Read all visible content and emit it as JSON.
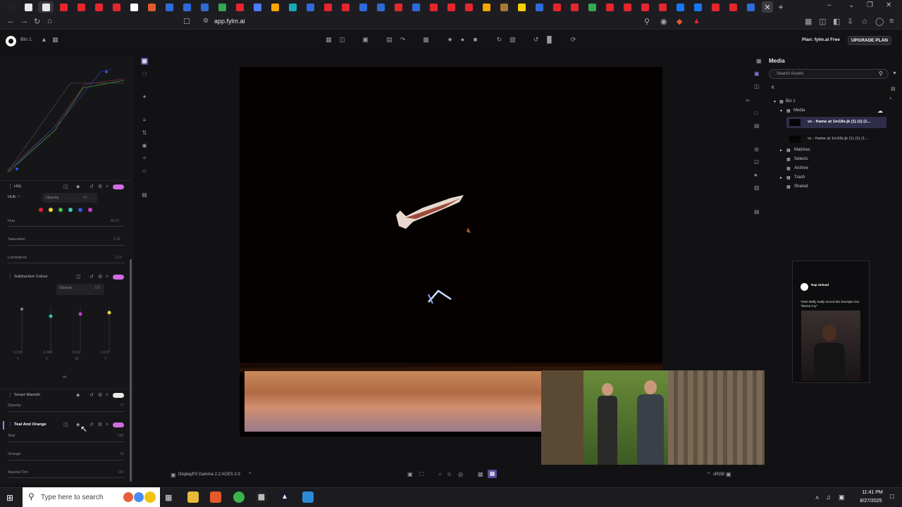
{
  "browser": {
    "url": "app.fylm.ai",
    "tab_count": 44,
    "tab_colors": [
      "#222",
      "#e8e8e8",
      "#e8e8e8",
      "#e5262d",
      "#e5262d",
      "#e5262d",
      "#e5262d",
      "#fff",
      "#e05a2c",
      "#2f6bd8",
      "#2f6bd8",
      "#2f6bd8",
      "#34a853",
      "#e5262d",
      "#4d7cff",
      "#f7a800",
      "#1ba9b5",
      "#2f6bd8",
      "#e5262d",
      "#e5262d",
      "#2f6bd8",
      "#2f6bd8",
      "#e5262d",
      "#2f6bd8",
      "#e5262d",
      "#e5262d",
      "#e5262d",
      "#f7a800",
      "#a57a33",
      "#f4d000",
      "#2f6bd8",
      "#e5262d",
      "#e5262d",
      "#34a853",
      "#e5262d",
      "#e5262d",
      "#e5262d",
      "#e5262d",
      "#1877f2",
      "#1877f2",
      "#e5262d",
      "#e5262d",
      "#2f6bd8"
    ]
  },
  "app": {
    "project_name": "Bin 1",
    "plan_label": "Plan: fylm.ai Free",
    "upgrade_label": "UPGRADE PLAN"
  },
  "left_panel": {
    "hsl": {
      "title": "HSL",
      "mode": "HUE",
      "opacity_label": "Opacity",
      "opacity_value": "66",
      "hue_label": "Hue",
      "hue_value": "40.67",
      "saturation_label": "Saturation",
      "saturation_value": "1.02",
      "luminance_label": "Luminance",
      "luminance_value": "1.13",
      "swatches": [
        "#e2203a",
        "#f3d53a",
        "#3ec24f",
        "#38c9b1",
        "#3553e0",
        "#c93ad6"
      ]
    },
    "subtractive": {
      "title": "Subtractive Colour",
      "opacity_label": "Opacity",
      "opacity_value": "100",
      "values": [
        "0.218",
        "-0.048",
        "0.012",
        "0.072"
      ],
      "channels": [
        "Y",
        "C",
        "M",
        "Y"
      ]
    },
    "smart_warmth": {
      "title": "Smart Warmth",
      "opacity_label": "Opacity",
      "opacity_value": "77"
    },
    "teal_orange": {
      "title": "Teal And Orange",
      "teal_label": "Teal",
      "teal_value": "100",
      "orange_label": "Orange",
      "orange_value": "35",
      "neutral_label": "Neutral Tint",
      "neutral_value": "100"
    }
  },
  "media_panel": {
    "title": "Media",
    "search_placeholder": "Search Assets",
    "filter_letter": "K",
    "bin": "Bin 1",
    "media_folder": "Media",
    "clips": [
      "vc - frame at 1m18s.jk (1) (1) (1...",
      "vc - frame at 1m18s.jk (1) (1) (1..."
    ],
    "folders": [
      "Matches",
      "Selects",
      "Archive",
      "Trash",
      "Shared"
    ]
  },
  "phone_preview": {
    "account": "Rap Unload",
    "caption": "YNW Melly really turned this freestyle into \"Mama Cry\""
  },
  "viewer": {
    "color_space": "DisplayP3 Gamma 2.2 ACES 2.0",
    "output_space": "sRGB"
  },
  "taskbar": {
    "search_placeholder": "Type here to search",
    "time": "11:41 PM",
    "date": "8/27/2025"
  }
}
